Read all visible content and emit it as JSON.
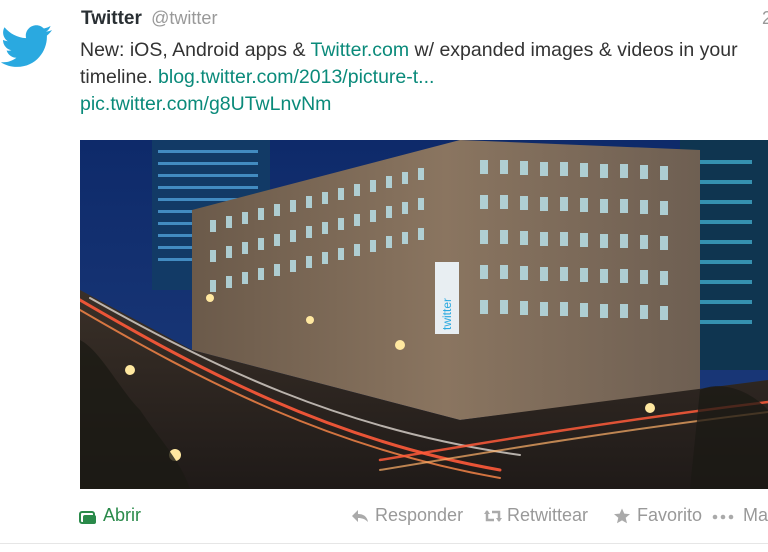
{
  "tweet": {
    "fullname": "Twitter",
    "username": "@twitter",
    "time": "2",
    "text_before": "New: iOS, Android apps & ",
    "text_link1": "Twitter.com",
    "text_middle": " w/ expanded images & videos in your timeline. ",
    "text_link2": "blog.twitter.com/2013/picture-t...",
    "text_link3": "pic.twitter.com/g8UTwLnvNm",
    "photo_sign": "twitter"
  },
  "actions": {
    "open": "Abrir",
    "reply": "Responder",
    "retweet": "Retwittear",
    "favorite": "Favorito",
    "more": "Ma"
  },
  "colors": {
    "link": "#0a8a7a",
    "brand_blue": "#2aa9e0",
    "open_green": "#2a8a4a",
    "muted": "#999999"
  },
  "icons": [
    "twitter-bird-icon",
    "open-card-icon",
    "reply-arrow-icon",
    "retweet-icon",
    "star-icon",
    "more-dots-icon"
  ]
}
